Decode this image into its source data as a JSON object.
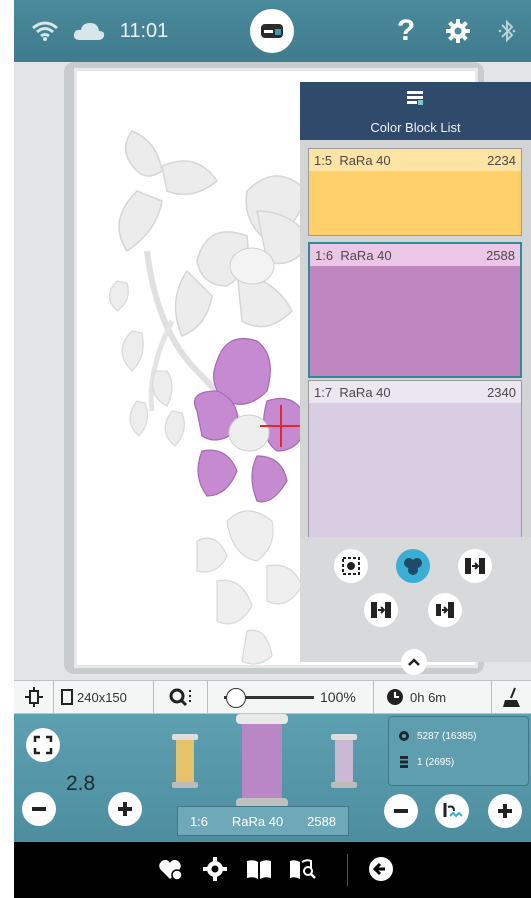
{
  "status": {
    "time": "11:01"
  },
  "color_block_list": {
    "title": "Color Block List",
    "blocks": [
      {
        "label": "1:5",
        "thread": "RaRa 40",
        "stitches": "2234",
        "color": "#ffd06a",
        "header_color": "#fde3a4",
        "selected": false
      },
      {
        "label": "1:6",
        "thread": "RaRa 40",
        "stitches": "2588",
        "color": "#bf86c0",
        "header_color": "#ecc6e6",
        "selected": true
      },
      {
        "label": "1:7",
        "thread": "RaRa 40",
        "stitches": "2340",
        "color": "#d8cde3",
        "header_color": "#ece6f0",
        "selected": false
      }
    ],
    "tools": [
      "select-area-icon",
      "color-blocks-icon",
      "merge-icon",
      "split-left-icon",
      "split-right-icon"
    ]
  },
  "info": {
    "hoop_size": "240x150",
    "zoom_percent": "100%",
    "zoom_level": 1.0,
    "time": "0h 6m"
  },
  "controls": {
    "zoom_value": "2.8",
    "current_thread": {
      "label": "1:6",
      "name": "RaRa 40",
      "stitches": "2588"
    },
    "stitch_total": "5287 (16385)",
    "color_count": "1 (2695)",
    "thread_colors": [
      "#e6c36b",
      "#b987c6",
      "#cbb9d3"
    ]
  },
  "nav": [
    "favorites-icon",
    "settings-icon",
    "book-icon",
    "book-search-icon",
    "back-icon"
  ]
}
